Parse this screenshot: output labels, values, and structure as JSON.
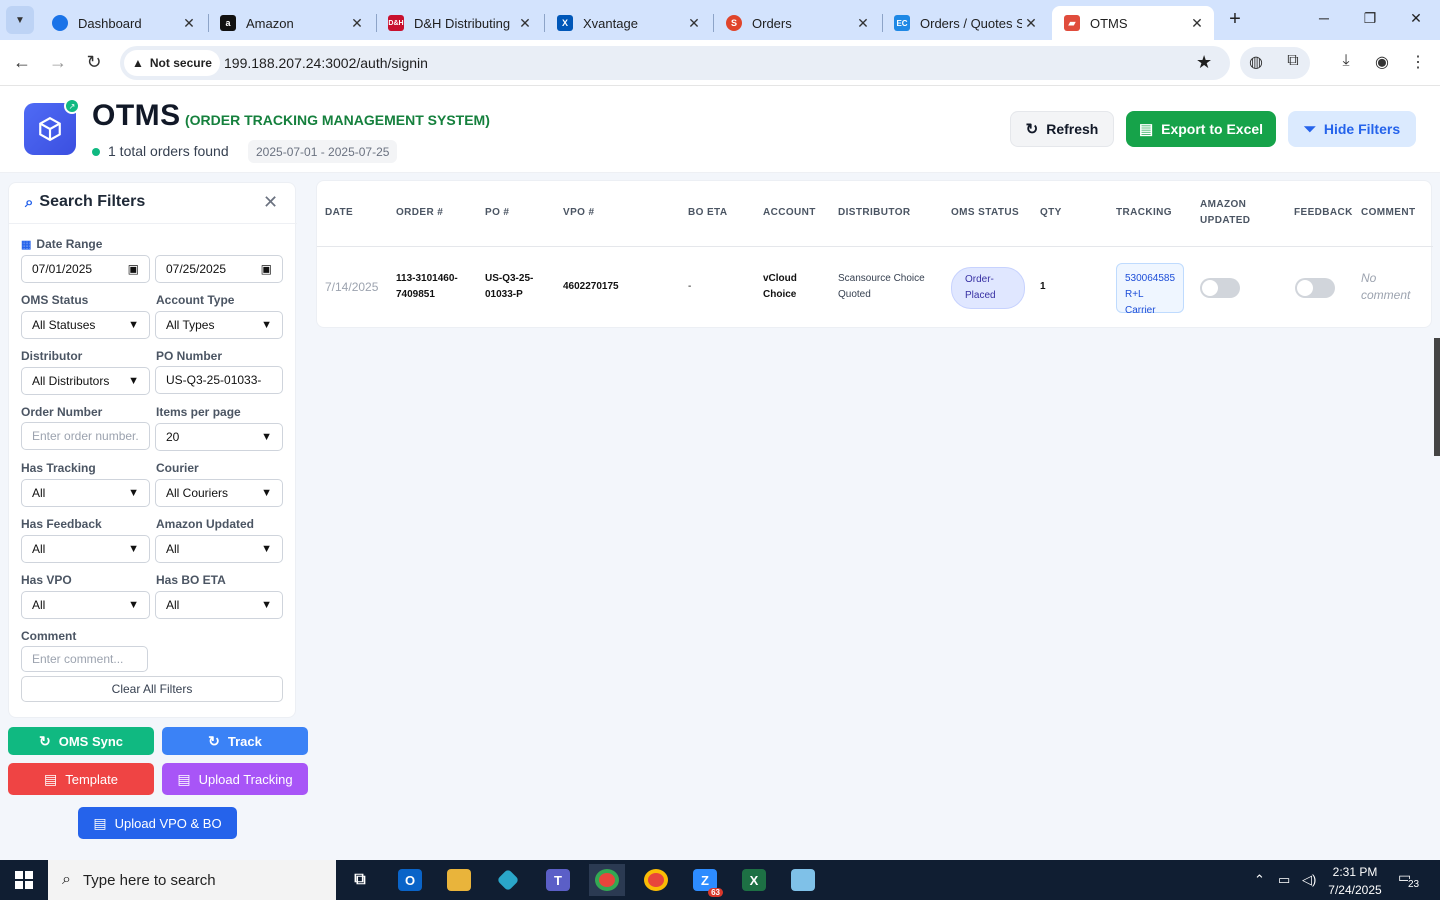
{
  "browser": {
    "tabs": [
      {
        "title": "Dashboard",
        "favicon": "globe-icon",
        "favicon_color": "#1a73e8"
      },
      {
        "title": "Amazon",
        "favicon": "amazon-icon",
        "favicon_color": "#111111"
      },
      {
        "title": "D&H Distributing",
        "favicon": "dh-icon",
        "favicon_color": "#c8102e"
      },
      {
        "title": "Xvantage",
        "favicon": "xvantage-icon",
        "favicon_color": "#0057b8"
      },
      {
        "title": "Orders",
        "favicon": "orders-icon",
        "favicon_color": "#e0452b"
      },
      {
        "title": "Orders / Quotes S",
        "favicon": "ec-icon",
        "favicon_color": "#1e88e5"
      },
      {
        "title": "OTMS",
        "favicon": "truck-icon",
        "favicon_color": "#e04c3c"
      }
    ],
    "security_label": "Not secure",
    "url": "199.188.207.24:3002/auth/signin"
  },
  "header": {
    "brand": "OTMS",
    "subtitle": "(ORDER TRACKING MANAGEMENT SYSTEM)",
    "orders_found": "1 total orders found",
    "date_range": "2025-07-01 - 2025-07-25",
    "refresh_label": "Refresh",
    "export_label": "Export to Excel",
    "hide_filters_label": "Hide Filters"
  },
  "filters": {
    "title": "Search Filters",
    "date_range_label": "Date Range",
    "date_from": "07/01/2025",
    "date_to": "07/25/2025",
    "oms_status_label": "OMS Status",
    "oms_status_value": "All Statuses",
    "account_type_label": "Account Type",
    "account_type_value": "All Types",
    "distributor_label": "Distributor",
    "distributor_value": "All Distributors",
    "po_number_label": "PO Number",
    "po_number_value": "US-Q3-25-01033-",
    "order_number_label": "Order Number",
    "order_number_placeholder": "Enter order number...",
    "items_per_page_label": "Items per page",
    "items_per_page_value": "20",
    "has_tracking_label": "Has Tracking",
    "has_tracking_value": "All",
    "courier_label": "Courier",
    "courier_value": "All Couriers",
    "has_feedback_label": "Has Feedback",
    "has_feedback_value": "All",
    "amazon_updated_label": "Amazon Updated",
    "amazon_updated_value": "All",
    "has_vpo_label": "Has VPO",
    "has_vpo_value": "All",
    "has_bo_eta_label": "Has BO ETA",
    "has_bo_eta_value": "All",
    "comment_label": "Comment",
    "comment_placeholder": "Enter comment...",
    "clear_label": "Clear All Filters"
  },
  "actions": {
    "oms_sync": "OMS Sync",
    "track": "Track",
    "template": "Template",
    "upload_tracking": "Upload Tracking",
    "upload_vpo_bo": "Upload VPO & BO"
  },
  "table": {
    "columns": {
      "date": "DATE",
      "order": "ORDER #",
      "po": "PO #",
      "vpo": "VPO #",
      "bo_eta": "BO ETA",
      "account": "ACCOUNT",
      "distributor": "DISTRIBUTOR",
      "oms_status": "OMS STATUS",
      "qty": "QTY",
      "tracking": "TRACKING",
      "amazon_updated_1": "AMAZON",
      "amazon_updated_2": "UPDATED",
      "feedback": "FEEDBACK",
      "comment": "COMMENT"
    },
    "row": {
      "date": "7/14/2025",
      "order_1": "113-3101460-",
      "order_2": "7409851",
      "po_1": "US-Q3-25-",
      "po_2": "01033-P",
      "vpo": "4602270175",
      "bo_eta": "-",
      "account_1": "vCloud",
      "account_2": "Choice",
      "distributor_1": "Scansource Choice",
      "distributor_2": "Quoted",
      "status_1": "Order-",
      "status_2": "Placed",
      "qty": "1",
      "tracking_number": "530064585",
      "tracking_carrier": "R+L Carrier",
      "amazon_updated": false,
      "feedback": false,
      "comment_1": "No",
      "comment_2": "comment"
    }
  },
  "taskbar": {
    "search_placeholder": "Type here to search",
    "time": "2:31 PM",
    "date": "7/24/2025",
    "zoom_badge": "63",
    "notifications": "23"
  },
  "colors": {
    "primary_green": "#16a34a",
    "primary_blue": "#2563eb",
    "light_blue": "#dbeafe",
    "red": "#ef4444",
    "purple": "#a855f7",
    "teal": "#10b981",
    "indigo": "#4f6bf5"
  }
}
